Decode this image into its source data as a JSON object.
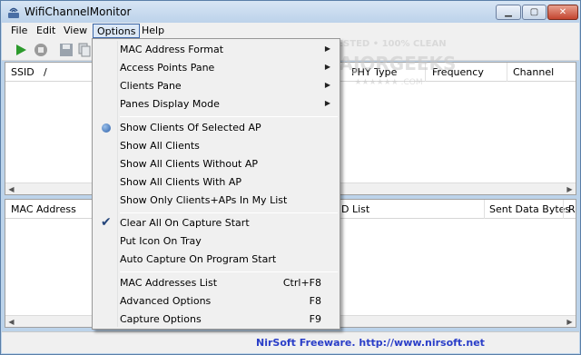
{
  "window": {
    "title": "WifiChannelMonitor",
    "min_glyph": "▁",
    "max_glyph": "▢",
    "close_glyph": "✕"
  },
  "menubar": {
    "items": [
      "File",
      "Edit",
      "View",
      "Options",
      "Help"
    ]
  },
  "top_pane": {
    "columns": [
      "SSID",
      "/",
      "PHY Type",
      "Frequency",
      "Channel"
    ]
  },
  "bottom_pane": {
    "columns": [
      "MAC Address",
      "D List",
      "Sent Data Bytes",
      "R"
    ]
  },
  "dropdown": {
    "items": [
      {
        "label": "MAC Address Format",
        "submenu": true
      },
      {
        "label": "Access Points Pane",
        "submenu": true
      },
      {
        "label": "Clients Pane",
        "submenu": true
      },
      {
        "label": "Panes Display Mode",
        "submenu": true
      },
      {
        "label": "Show Clients Of Selected AP",
        "mark": "radio"
      },
      {
        "label": "Show All Clients"
      },
      {
        "label": "Show All Clients Without AP"
      },
      {
        "label": "Show All Clients With AP"
      },
      {
        "label": "Show Only Clients+APs In My List"
      },
      {
        "label": "Clear All On Capture Start",
        "mark": "check"
      },
      {
        "label": "Put Icon On Tray"
      },
      {
        "label": "Auto Capture On Program Start"
      },
      {
        "label": "MAC Addresses List",
        "shortcut": "Ctrl+F8"
      },
      {
        "label": "Advanced Options",
        "shortcut": "F8"
      },
      {
        "label": "Capture Options",
        "shortcut": "F9"
      }
    ],
    "submenu_arrow": "▶",
    "check_glyph": "✔"
  },
  "status": {
    "text": "NirSoft Freeware.  http://www.nirsoft.net"
  },
  "watermark": {
    "line1": "TESTED • 100% CLEAN",
    "line2": "MAJORGEEKS",
    "line3": "★★★★★★ .COM"
  },
  "colors": {
    "accent": "#2a3ec8",
    "titlebar": "#bcd2ea",
    "menu_bg": "#f0f0f0"
  }
}
